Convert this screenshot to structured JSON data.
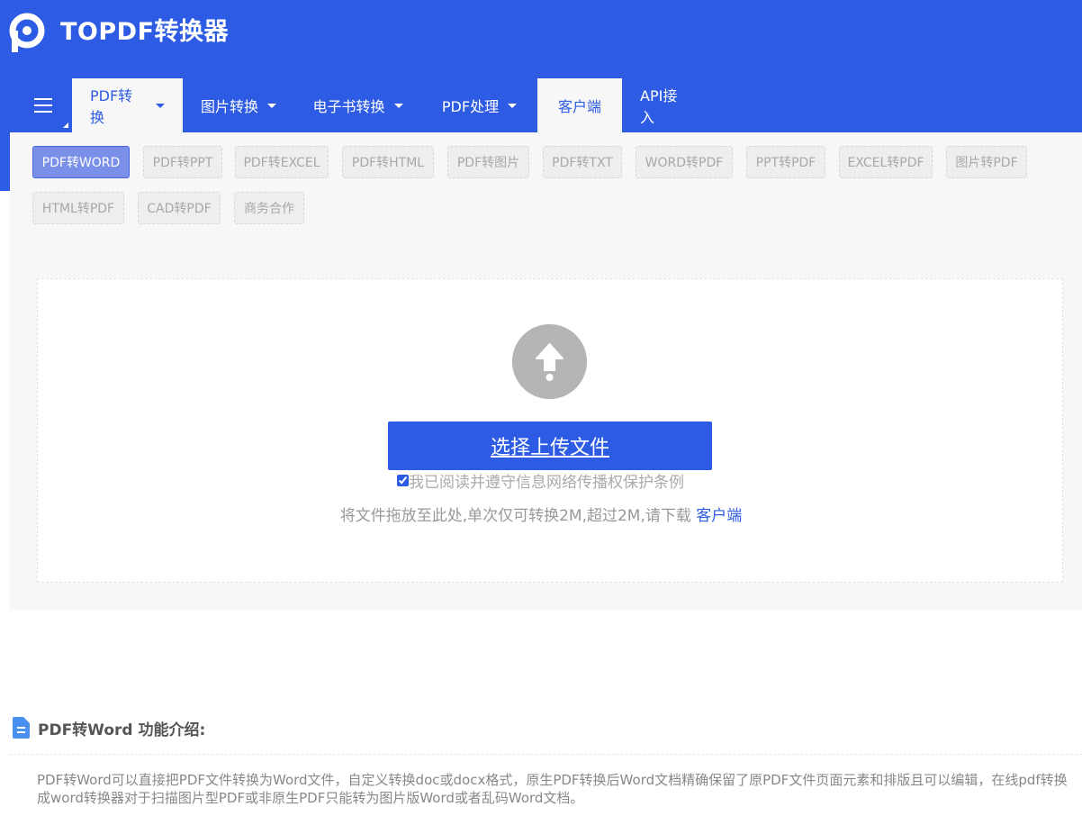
{
  "header": {
    "brand": "TOPDF转换器",
    "colors": {
      "primary": "#2d5be3",
      "panel": "#f7f7f7"
    }
  },
  "nav": {
    "menu_icon": "hamburger-icon",
    "items": [
      {
        "label": "PDF转换",
        "dropdown": true,
        "active": true
      },
      {
        "label": "图片转换",
        "dropdown": true,
        "active": false
      },
      {
        "label": "电子书转换",
        "dropdown": true,
        "active": false
      },
      {
        "label": "PDF处理",
        "dropdown": true,
        "active": false
      },
      {
        "label": "客户端",
        "dropdown": false,
        "active": true
      },
      {
        "label": "API接入",
        "dropdown": false,
        "active": false
      }
    ]
  },
  "tools": [
    {
      "label": "PDF转WORD",
      "active": true
    },
    {
      "label": "PDF转PPT"
    },
    {
      "label": "PDF转EXCEL"
    },
    {
      "label": "PDF转HTML"
    },
    {
      "label": "PDF转图片"
    },
    {
      "label": "PDF转TXT"
    },
    {
      "label": "WORD转PDF"
    },
    {
      "label": "PPT转PDF"
    },
    {
      "label": "EXCEL转PDF"
    },
    {
      "label": "图片转PDF"
    },
    {
      "label": "HTML转PDF"
    },
    {
      "label": "CAD转PDF"
    },
    {
      "label": "商务合作"
    }
  ],
  "upload": {
    "icon": "upload-arrow-icon",
    "button_label": "选择上传文件",
    "agree_checked": true,
    "agree_text": "我已阅读并遵守信息网络传播权保护条例",
    "hint_text": "将文件拖放至此处,单次仅可转换2M,超过2M,请下载",
    "hint_link": "客户端"
  },
  "intro": {
    "icon": "document-icon",
    "title": "PDF转Word 功能介绍:",
    "paragraph": "PDF转Word可以直接把PDF文件转换为Word文件，自定义转换doc或docx格式，原生PDF转换后Word文档精确保留了原PDF文件页面元素和排版且可以编辑，在线pdf转换成word转换器对于扫描图片型PDF或非原生PDF只能转为图片版Word或者乱码Word文档。"
  }
}
